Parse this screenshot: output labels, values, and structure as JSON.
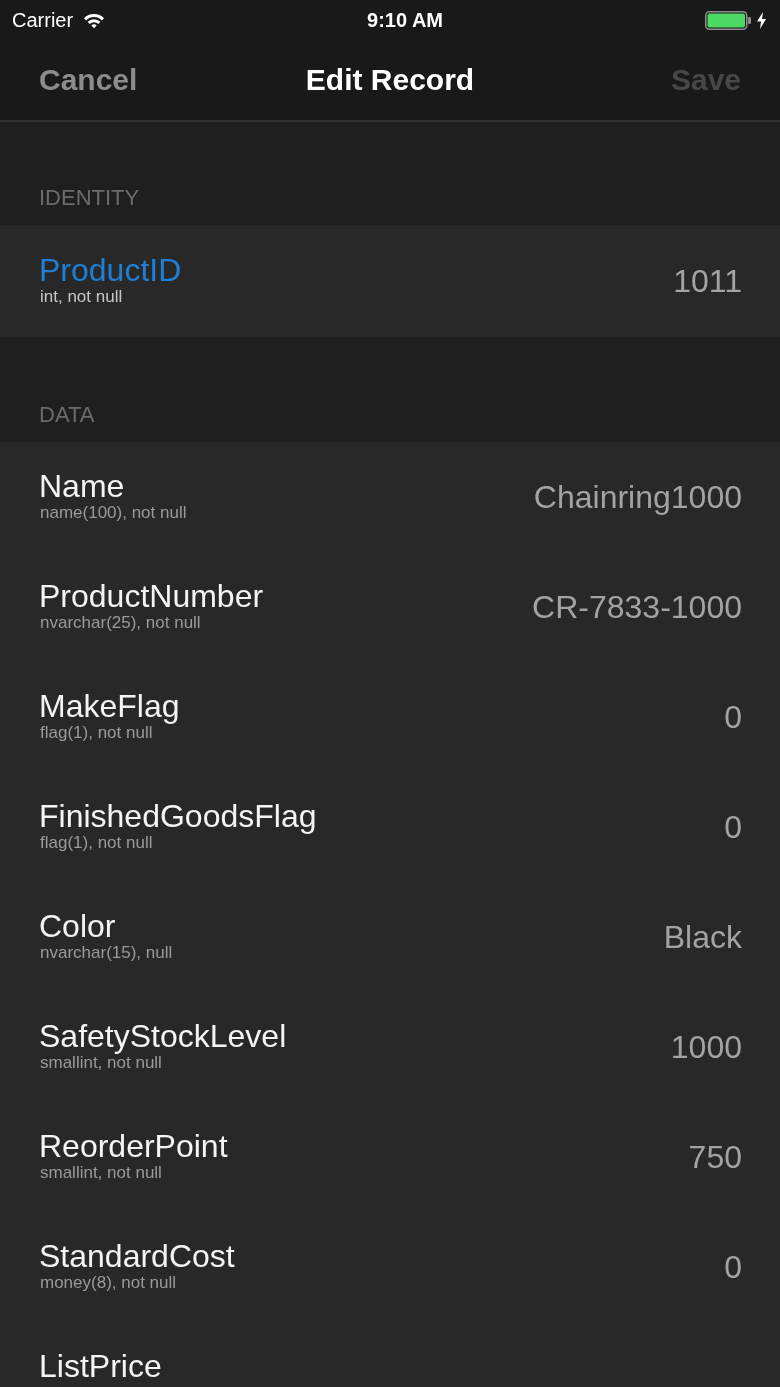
{
  "status_bar": {
    "carrier": "Carrier",
    "time": "9:10 AM",
    "charging": true
  },
  "nav_bar": {
    "title": "Edit Record",
    "cancel": {
      "label": "Cancel",
      "disabled": false
    },
    "save": {
      "label": "Save",
      "disabled": true
    }
  },
  "sections": [
    {
      "title": "IDENTITY",
      "rows": [
        {
          "kind": "key",
          "name": "ProductID",
          "type": "int, not null",
          "value": "1011"
        }
      ]
    },
    {
      "title": "DATA",
      "rows": [
        {
          "kind": "column",
          "name": "Name",
          "type": "name(100), not null",
          "value": "Chainring1000"
        },
        {
          "kind": "column",
          "name": "ProductNumber",
          "type": "nvarchar(25), not null",
          "value": "CR-7833-1000"
        },
        {
          "kind": "column",
          "name": "MakeFlag",
          "type": "flag(1), not null",
          "value": "0"
        },
        {
          "kind": "column",
          "name": "FinishedGoodsFlag",
          "type": "flag(1), not null",
          "value": "0"
        },
        {
          "kind": "column",
          "name": "Color",
          "type": "nvarchar(15), null",
          "value": "Black"
        },
        {
          "kind": "column",
          "name": "SafetyStockLevel",
          "type": "smallint, not null",
          "value": "1000"
        },
        {
          "kind": "column",
          "name": "ReorderPoint",
          "type": "smallint, not null",
          "value": "750"
        },
        {
          "kind": "column",
          "name": "StandardCost",
          "type": "money(8), not null",
          "value": "0"
        },
        {
          "kind": "column",
          "name": "ListPrice"
        }
      ]
    }
  ]
}
